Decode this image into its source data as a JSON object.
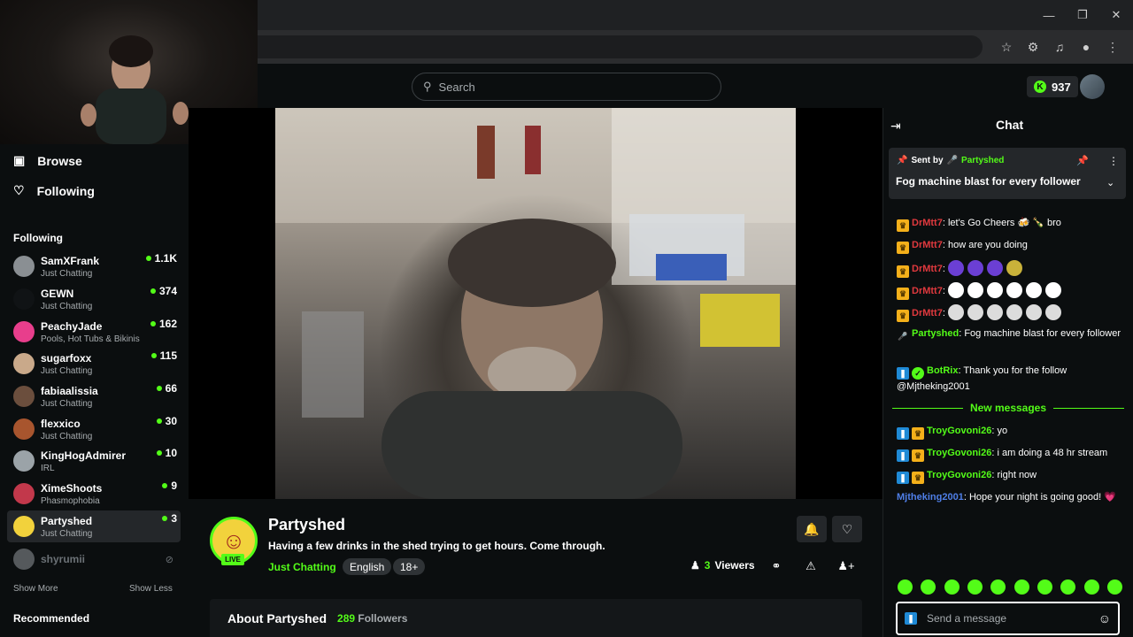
{
  "header": {
    "search_placeholder": "Search",
    "kicks_count": "937"
  },
  "sidebar": {
    "browse": "Browse",
    "following_link": "Following",
    "following_title": "Following",
    "channels": [
      {
        "name": "SamXFrank",
        "category": "Just Chatting",
        "viewers": "1.1K",
        "avatar": "#8a8f93",
        "live": true
      },
      {
        "name": "GEWN",
        "category": "Just Chatting",
        "viewers": "374",
        "avatar": "#101315",
        "live": true
      },
      {
        "name": "PeachyJade",
        "category": "Pools, Hot Tubs & Bikinis",
        "viewers": "162",
        "avatar": "#e83e8c",
        "live": true
      },
      {
        "name": "sugarfoxx",
        "category": "Just Chatting",
        "viewers": "115",
        "avatar": "#c9a98a",
        "live": true
      },
      {
        "name": "fabiaalissia",
        "category": "Just Chatting",
        "viewers": "66",
        "avatar": "#6b4e3d",
        "live": true
      },
      {
        "name": "flexxico",
        "category": "Just Chatting",
        "viewers": "30",
        "avatar": "#a8552e",
        "live": true
      },
      {
        "name": "KingHogAdmirer",
        "category": "IRL",
        "viewers": "10",
        "avatar": "#9ba3a8",
        "live": true
      },
      {
        "name": "XimeShoots",
        "category": "Phasmophobia",
        "viewers": "9",
        "avatar": "#c2384b",
        "live": true
      },
      {
        "name": "Partyshed",
        "category": "Just Chatting",
        "viewers": "3",
        "avatar": "#f2d23c",
        "live": true
      },
      {
        "name": "shyrumii",
        "category": "",
        "viewers": "",
        "avatar": "#55595c",
        "live": false
      }
    ],
    "show_more": "Show More",
    "show_less": "Show Less",
    "recommended_title": "Recommended"
  },
  "stream": {
    "streamer": "Partyshed",
    "live_label": "LIVE",
    "title": "Having a few drinks in the shed trying to get hours. Come through.",
    "category": "Just Chatting",
    "tags": [
      "English",
      "18+"
    ],
    "viewers_count": "3",
    "viewers_label": "Viewers",
    "about_label": "About Partyshed",
    "followers_count": "289",
    "followers_label": "Followers"
  },
  "chat": {
    "title": "Chat",
    "pinned_sent_by": "Sent by",
    "pinned_user": "Partyshed",
    "pinned_text": "Fog machine blast for every follower",
    "messages": [
      {
        "user": "DrMtt7",
        "text": "let's Go Cheers 🍻 🍾 bro",
        "color": "#e0393e"
      },
      {
        "user": "DrMtt7",
        "text": "how are you doing",
        "color": "#e0393e"
      },
      {
        "user": "DrMtt7",
        "text": "",
        "color": "#e0393e"
      },
      {
        "user": "DrMtt7",
        "text": "",
        "color": "#e0393e"
      },
      {
        "user": "DrMtt7",
        "text": "",
        "color": "#e0393e"
      },
      {
        "user": "Partyshed",
        "text": "Fog machine blast for every follower",
        "color": "#53fc18"
      },
      {
        "user": "BotRix",
        "text": "Thank you for the follow @Mjtheking2001",
        "color": "#53fc18"
      }
    ],
    "new_messages_label": "New messages",
    "new_messages": [
      {
        "user": "TroyGovoni26",
        "text": "yo",
        "color": "#53fc18"
      },
      {
        "user": "TroyGovoni26",
        "text": "i am doing a 48 hr stream",
        "color": "#53fc18"
      },
      {
        "user": "TroyGovoni26",
        "text": "right now",
        "color": "#53fc18"
      },
      {
        "user": "Mjtheking2001",
        "text": "Hope your night is going good! 💗",
        "color": "#4f7fe8"
      }
    ],
    "input_placeholder": "Send a message"
  }
}
